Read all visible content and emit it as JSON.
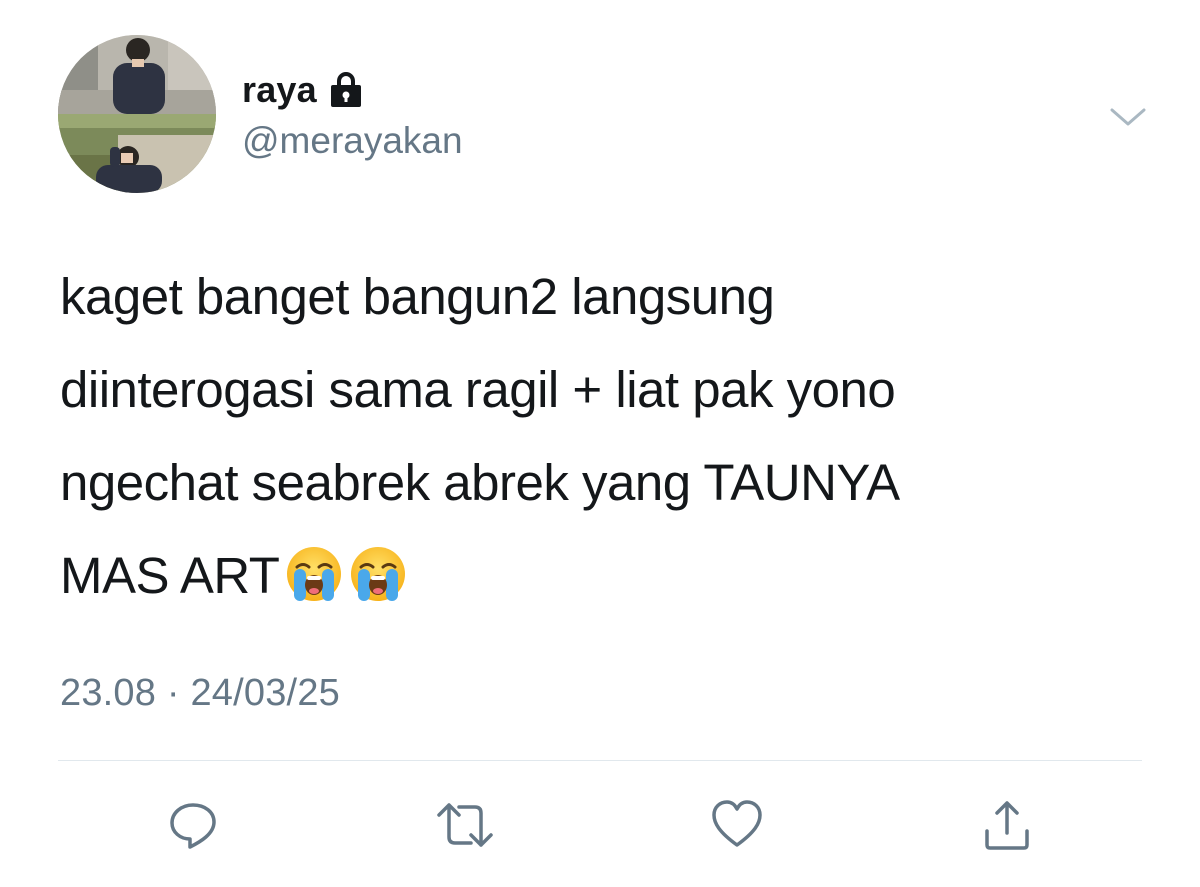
{
  "user": {
    "display_name": "raya",
    "handle": "@merayakan",
    "protected_icon": "lock-icon",
    "avatar_icon": "profile-photo"
  },
  "tweet": {
    "lines": [
      "kaget banget bangun2 langsung",
      "diinterogasi sama ragil + liat pak yono",
      "ngechat seabrek abrek yang TAUNYA",
      "MAS ART"
    ],
    "emoji": [
      "loudly-crying-face",
      "loudly-crying-face"
    ],
    "timestamp": "23.08 · 24/03/25"
  },
  "header": {
    "more_icon": "chevron-down-icon"
  },
  "actions": [
    {
      "name": "reply",
      "icon": "reply-icon"
    },
    {
      "name": "retweet",
      "icon": "retweet-icon"
    },
    {
      "name": "like",
      "icon": "heart-icon"
    },
    {
      "name": "share",
      "icon": "share-icon"
    }
  ],
  "colors": {
    "text": "#14171a",
    "secondary": "#657786",
    "icon": "#657786",
    "divider": "#e1e8ed"
  }
}
